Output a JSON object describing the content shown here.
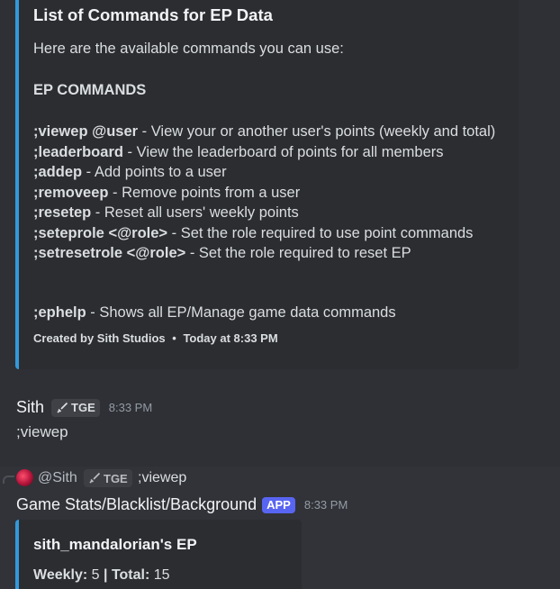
{
  "embed_1": {
    "title": "List of Commands for EP Data",
    "intro": "Here are the available commands you can use:",
    "section_heading": "EP COMMANDS",
    "commands": [
      {
        "name": ";viewep @user",
        "desc": " - View your or another user's points (weekly and total)"
      },
      {
        "name": ";leaderboard",
        "desc": " - View the leaderboard of points for all members"
      },
      {
        "name": ";addep",
        "desc": " - Add points to a user"
      },
      {
        "name": ";removeep",
        "desc": " - Remove points from a user"
      },
      {
        "name": ";resetep",
        "desc": " - Reset all users' weekly points"
      },
      {
        "name": ";seteprole <@role>",
        "desc": " - Set the role required to use point commands"
      },
      {
        "name": ";setresetrole <@role>",
        "desc": " - Set the role required to reset EP"
      }
    ],
    "help_command": {
      "name": ";ephelp",
      "desc": " - Shows all EP/Manage game data commands"
    },
    "footer_author": "Created by Sith Studios",
    "footer_separator": "•",
    "footer_time": "Today at 8:33 PM",
    "accent_color": "#3498db"
  },
  "user_message": {
    "author": "Sith",
    "tag": "TGE",
    "tag_icon": "sword-icon",
    "timestamp": "8:33 PM",
    "content": ";viewep"
  },
  "bot_reply": {
    "reply_user": "@Sith",
    "reply_tag": "TGE",
    "reply_text": ";viewep",
    "bot_name": "Game Stats/Blacklist/Background",
    "badge": "APP",
    "timestamp": "8:33 PM",
    "embed": {
      "title": "sith_mandalorian's EP",
      "weekly_label": "Weekly:",
      "weekly_value": "5",
      "separator": "|",
      "total_label": "Total:",
      "total_value": "15"
    }
  }
}
